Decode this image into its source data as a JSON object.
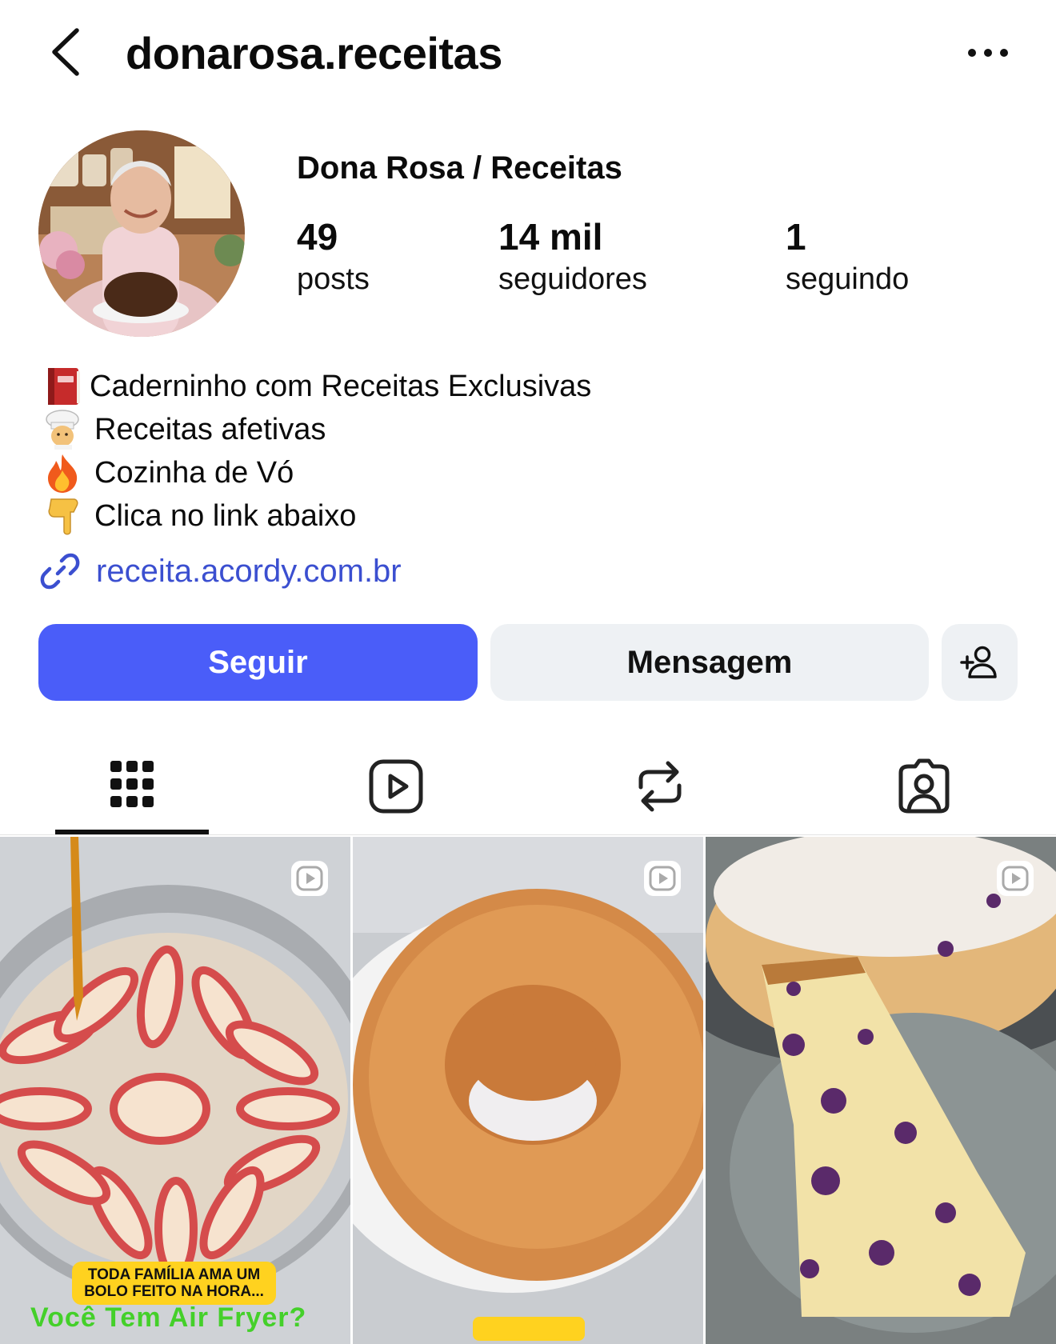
{
  "header": {
    "username": "donarosa.receitas",
    "back_icon": "chevron-left-icon",
    "more_icon": "more-horizontal-icon"
  },
  "profile": {
    "display_name": "Dona Rosa / Receitas",
    "stats": {
      "posts": {
        "value": "49",
        "label": "posts"
      },
      "followers": {
        "value": "14 mil",
        "label": "seguidores"
      },
      "following": {
        "value": "1",
        "label": "seguindo"
      }
    }
  },
  "bio": {
    "lines": [
      {
        "emoji": "book-icon",
        "text": "Caderninho com Receitas Exclusivas"
      },
      {
        "emoji": "chef-icon",
        "text": "Receitas afetivas"
      },
      {
        "emoji": "fire-icon",
        "text": "Cozinha de Vó"
      },
      {
        "emoji": "pointing-down-icon",
        "text": "Clica no link abaixo"
      }
    ],
    "link": "receita.acordy.com.br"
  },
  "actions": {
    "follow_label": "Seguir",
    "message_label": "Mensagem",
    "add_user_icon": "add-user-icon"
  },
  "tabs": [
    {
      "name": "posts-grid",
      "icon": "grid-icon",
      "active": true
    },
    {
      "name": "reels",
      "icon": "reels-icon",
      "active": false
    },
    {
      "name": "reposts",
      "icon": "repost-icon",
      "active": false
    },
    {
      "name": "tagged",
      "icon": "tagged-user-icon",
      "active": false
    }
  ],
  "grid": {
    "posts": [
      {
        "type": "reel",
        "caption": "TODA FAMÍLIA AMA UM BOLO FEITO NA HORA...",
        "overlay_text": "Você Tem Air Fryer?"
      },
      {
        "type": "reel"
      },
      {
        "type": "reel"
      }
    ]
  },
  "colors": {
    "follow_button": "#4a5df9",
    "secondary_button": "#eef1f4",
    "link": "#3b4fd0"
  }
}
